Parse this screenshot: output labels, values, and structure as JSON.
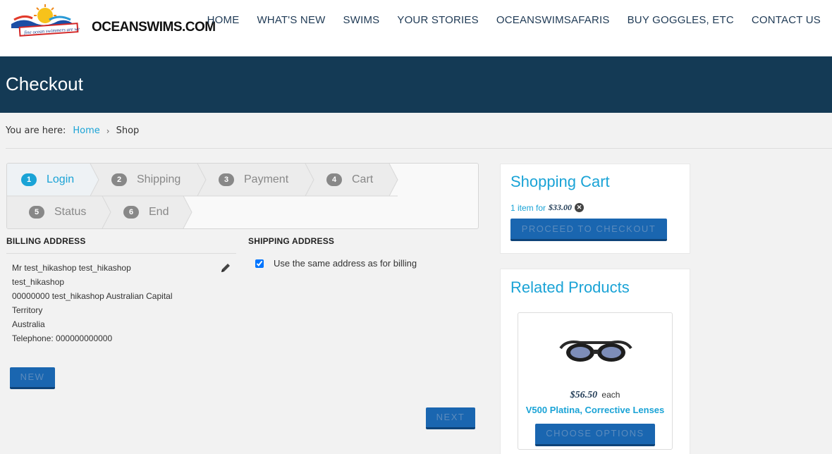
{
  "header": {
    "logo_text": "OCEANSWIMS.COM",
    "logo_tagline": "fine ocean swimmers are we",
    "nav": [
      "HOME",
      "WHAT'S NEW",
      "SWIMS",
      "YOUR STORIES",
      "OCEANSWIMSAFARIS",
      "BUY GOGGLES, ETC",
      "CONTACT US"
    ]
  },
  "page_title": "Checkout",
  "breadcrumb": {
    "prefix": "You are here:",
    "items": [
      "Home",
      "Shop"
    ]
  },
  "steps": [
    {
      "num": "1",
      "label": "Login",
      "active": true
    },
    {
      "num": "2",
      "label": "Shipping",
      "active": false
    },
    {
      "num": "3",
      "label": "Payment",
      "active": false
    },
    {
      "num": "4",
      "label": "Cart",
      "active": false
    },
    {
      "num": "5",
      "label": "Status",
      "active": false
    },
    {
      "num": "6",
      "label": "End",
      "active": false
    }
  ],
  "billing": {
    "title": "BILLING ADDRESS",
    "lines": [
      "Mr test_hikashop test_hikashop",
      "test_hikashop",
      "00000000 test_hikashop Australian Capital",
      "Territory",
      "Australia",
      "Telephone: 000000000000"
    ],
    "new_label": "NEW"
  },
  "shipping": {
    "title": "SHIPPING ADDRESS",
    "same_label": "Use the same address as for billing",
    "same_checked": true
  },
  "next_label": "NEXT",
  "cart": {
    "title": "Shopping Cart",
    "summary": "1 item for",
    "total": "$33.00",
    "checkout_label": "PROCEED TO CHECKOUT"
  },
  "related": {
    "title": "Related Products",
    "product": {
      "price": "$56.50",
      "unit": "each",
      "name": "V500 Platina, Corrective Lenses",
      "options_label": "CHOOSE OPTIONS"
    }
  },
  "colors": {
    "accent": "#1aa3d6",
    "navy": "#143a55",
    "button": "#1a66b0"
  }
}
